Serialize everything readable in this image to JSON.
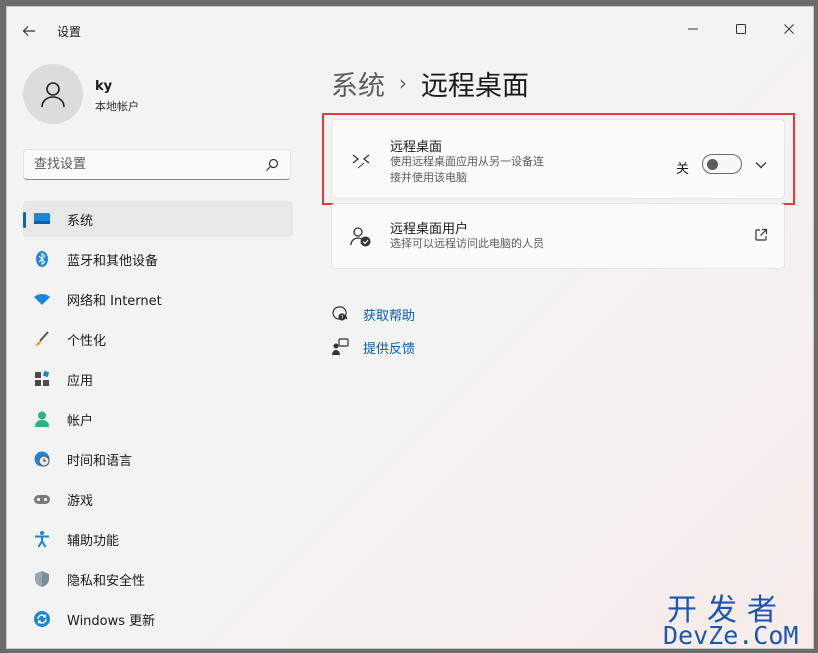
{
  "window": {
    "title": "设置"
  },
  "profile": {
    "name": "ky",
    "account_type": "本地帐户"
  },
  "search": {
    "placeholder": "查找设置"
  },
  "sidebar": {
    "items": [
      {
        "label": "系统",
        "icon": "system-icon",
        "active": true
      },
      {
        "label": "蓝牙和其他设备",
        "icon": "bluetooth-icon"
      },
      {
        "label": "网络和 Internet",
        "icon": "wifi-icon"
      },
      {
        "label": "个性化",
        "icon": "brush-icon"
      },
      {
        "label": "应用",
        "icon": "apps-icon"
      },
      {
        "label": "帐户",
        "icon": "account-icon"
      },
      {
        "label": "时间和语言",
        "icon": "time-language-icon"
      },
      {
        "label": "游戏",
        "icon": "gamepad-icon"
      },
      {
        "label": "辅助功能",
        "icon": "accessibility-icon"
      },
      {
        "label": "隐私和安全性",
        "icon": "shield-icon"
      },
      {
        "label": "Windows 更新",
        "icon": "update-icon"
      }
    ]
  },
  "breadcrumb": {
    "parent": "系统",
    "separator": "›",
    "current": "远程桌面"
  },
  "remote_desktop": {
    "title": "远程桌面",
    "description_line1": "使用远程桌面应用从另一设备连",
    "description_line2": "接并使用该电脑",
    "toggle_state": "关",
    "enabled": false
  },
  "remote_users": {
    "title": "远程桌面用户",
    "description": "选择可以远程访问此电脑的人员"
  },
  "links": {
    "help": "获取帮助",
    "feedback": "提供反馈"
  },
  "watermark": {
    "cn": "开发者",
    "en": "DevZe.CoM"
  },
  "colors": {
    "accent": "#0067c0",
    "highlight": "#e53935",
    "link": "#0a5ea8"
  }
}
